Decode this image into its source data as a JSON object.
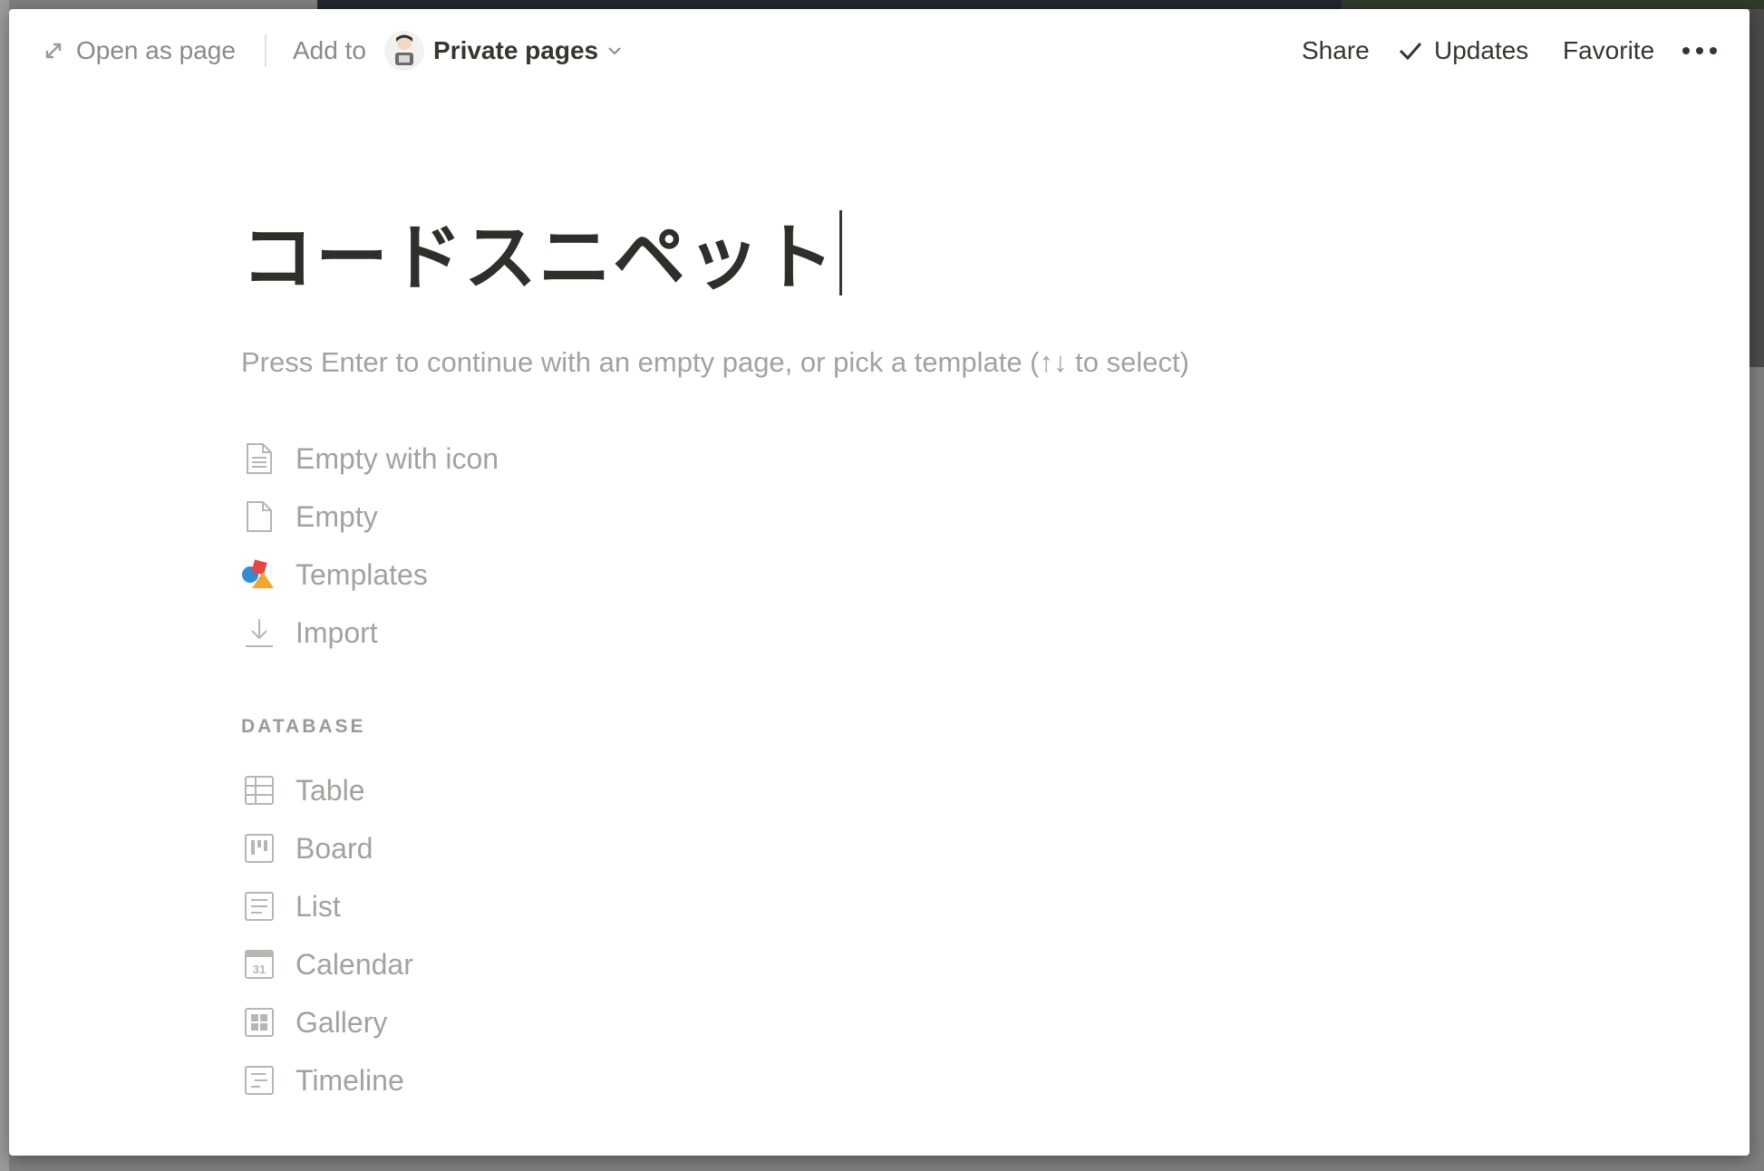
{
  "topbar": {
    "open_as_page": "Open as page",
    "add_to": "Add to",
    "workspace": "Private pages",
    "share": "Share",
    "updates": "Updates",
    "favorite": "Favorite"
  },
  "page": {
    "title": "コードスニペット",
    "hint": "Press Enter to continue with an empty page, or pick a template (↑↓ to select)"
  },
  "templates": [
    {
      "label": "Empty with icon",
      "icon": "page-lines-icon"
    },
    {
      "label": "Empty",
      "icon": "page-icon"
    },
    {
      "label": "Templates",
      "icon": "shapes-icon"
    },
    {
      "label": "Import",
      "icon": "import-icon"
    }
  ],
  "database": {
    "label": "DATABASE",
    "items": [
      {
        "label": "Table",
        "icon": "table-icon"
      },
      {
        "label": "Board",
        "icon": "board-icon"
      },
      {
        "label": "List",
        "icon": "list-icon"
      },
      {
        "label": "Calendar",
        "icon": "calendar-icon",
        "icon_text": "31"
      },
      {
        "label": "Gallery",
        "icon": "gallery-icon"
      },
      {
        "label": "Timeline",
        "icon": "timeline-icon"
      }
    ]
  },
  "colors": {
    "text": "#37352f",
    "muted": "#a3a29e",
    "icon": "#b7b6b3"
  }
}
